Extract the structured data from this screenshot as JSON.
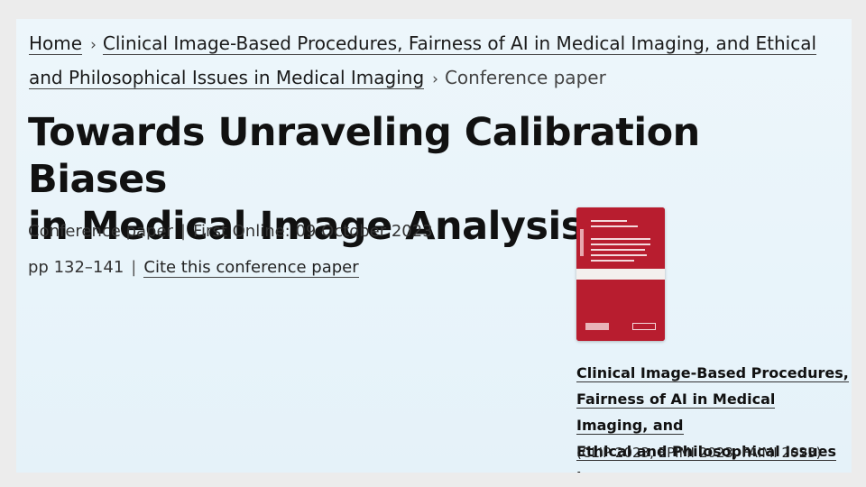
{
  "breadcrumb": {
    "home": "Home",
    "parent": "Clinical Image-Based Procedures, Fairness of AI in Medical Imaging, and Ethical and Philosophical Issues in Medical Imaging",
    "current": "Conference paper",
    "separator": "›"
  },
  "paper": {
    "title_line1": "Towards Unraveling Calibration Biases",
    "title_line2": "in Medical Image Analysis",
    "type": "Conference paper",
    "first_online": "First Online: 09 October 2023",
    "pages": "pp 132–141",
    "cite_label": "Cite this conference paper",
    "meta_separator": "|"
  },
  "book": {
    "title_line1": "Clinical Image-Based Procedures,",
    "title_line2": "Fairness of AI in Medical Imaging, and",
    "title_line3": "Ethical and Philosophical Issues in...",
    "acronyms": "(CLIP 2023, EPIMI 2023, FAIMI 2023)",
    "cover_icon": "book-cover-image"
  },
  "colors": {
    "background": "#ececec",
    "panel": "#e9f4fa",
    "cover_red": "#b81d2f",
    "text": "#111111"
  }
}
